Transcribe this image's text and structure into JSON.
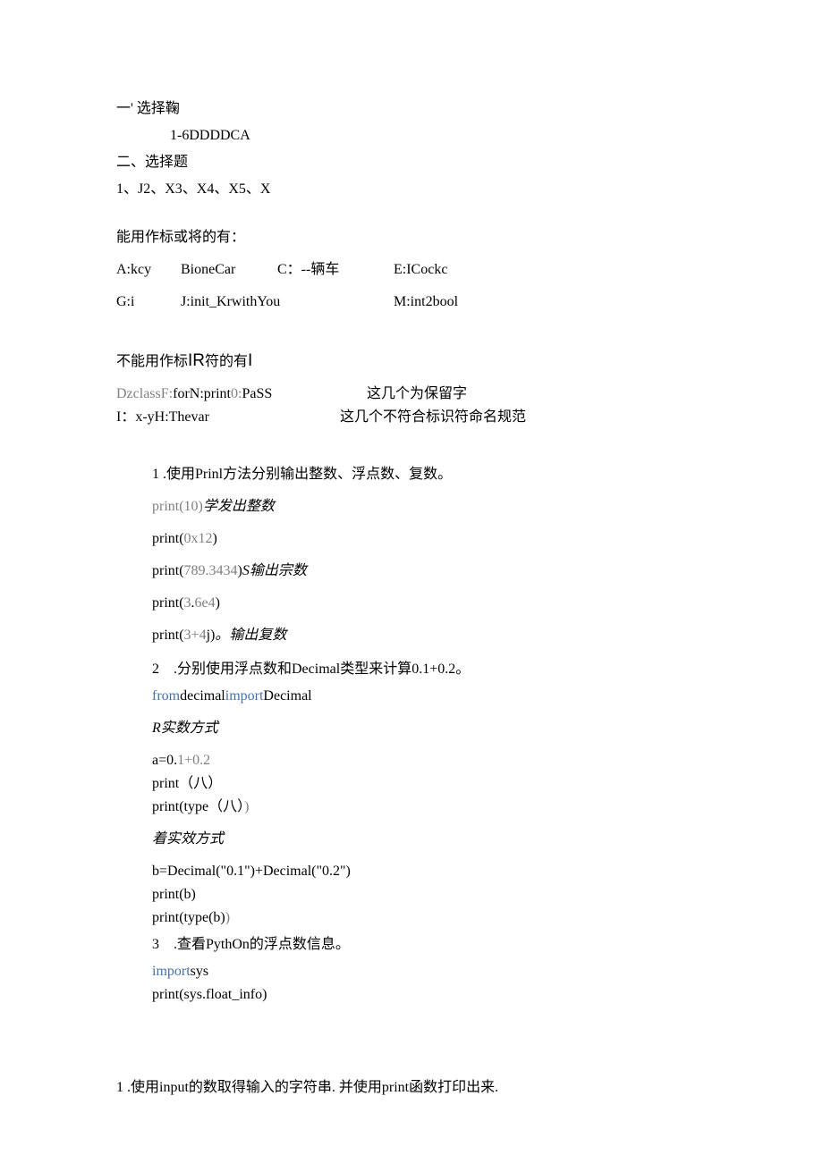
{
  "header": {
    "line1_a": "一'",
    "line1_b": "选择鞠",
    "line2": "1-6DDDDCA",
    "line3": "二、选择题",
    "line4": "1、J2、X3、X4、X5、X"
  },
  "sec_can": {
    "title": "能用作标或将的有：",
    "row1_c1": "A:kcy",
    "row1_c2": "BioneCar",
    "row1_c3": "C：--辆车",
    "row1_c4": "E:ICockc",
    "row2_c1": "G:i",
    "row2_c2": "J:init_KrwithYou",
    "row2_c4": "M:int2bool"
  },
  "sec_cannot": {
    "title_a": "不能用作标",
    "title_b": "IR",
    "title_c": "符的有",
    "title_d": "I",
    "row1_left_a": "DzclassF:",
    "row1_left_b": "forN:print",
    "row1_left_c": "0:",
    "row1_left_d": "PaSS",
    "row1_right": "这几个为保留字",
    "row2_left": "I：x-yH:Thevar",
    "row2_right": "这几个不符合标识符命名规范"
  },
  "q1": {
    "title": "1 .使用Prinl方法分别输出整数、浮点数、复数。",
    "l1_a": "print(10)",
    "l1_b": "学发出整数",
    "l2_a": "print(",
    "l2_b": "0x12",
    "l2_c": ")",
    "l3_a": "print(",
    "l3_b": "789.3434",
    "l3_c": ")",
    "l3_d": "S输出宗数",
    "l4_a": "print(",
    "l4_b": "3",
    "l4_c": ".",
    "l4_d": "6e4",
    "l4_e": ")",
    "l5_a": "print(",
    "l5_b": "3+4",
    "l5_c": "j)",
    "l5_d": "。",
    "l5_e": "输出复数"
  },
  "q2": {
    "title": "2　.分别使用浮点数和Decimal类型来计算0.1+0.2。",
    "imp_a": "from",
    "imp_b": "decimal",
    "imp_c": "import",
    "imp_d": "Decimal",
    "sub1": "R实数方式",
    "l1_a": "a=0.",
    "l1_b": "1+0.2",
    "l2": "print（八）",
    "l3_a": "print(type（八）",
    "l3_b": ")",
    "sub2": "着实效方式",
    "l4": "b=Decimal(\"0.1\")+Decimal(\"0.2\")",
    "l5": "print(b)",
    "l6_a": "print(type(b)",
    "l6_b": ")"
  },
  "q3": {
    "title": "3　.查看PythOn的浮点数信息。",
    "l1_a": "import",
    "l1_b": "sys",
    "l2": "print(sys.float_info)"
  },
  "footer": {
    "line": "1 .使用input的数取得输入的字符串. 并使用print函数打印出来."
  }
}
